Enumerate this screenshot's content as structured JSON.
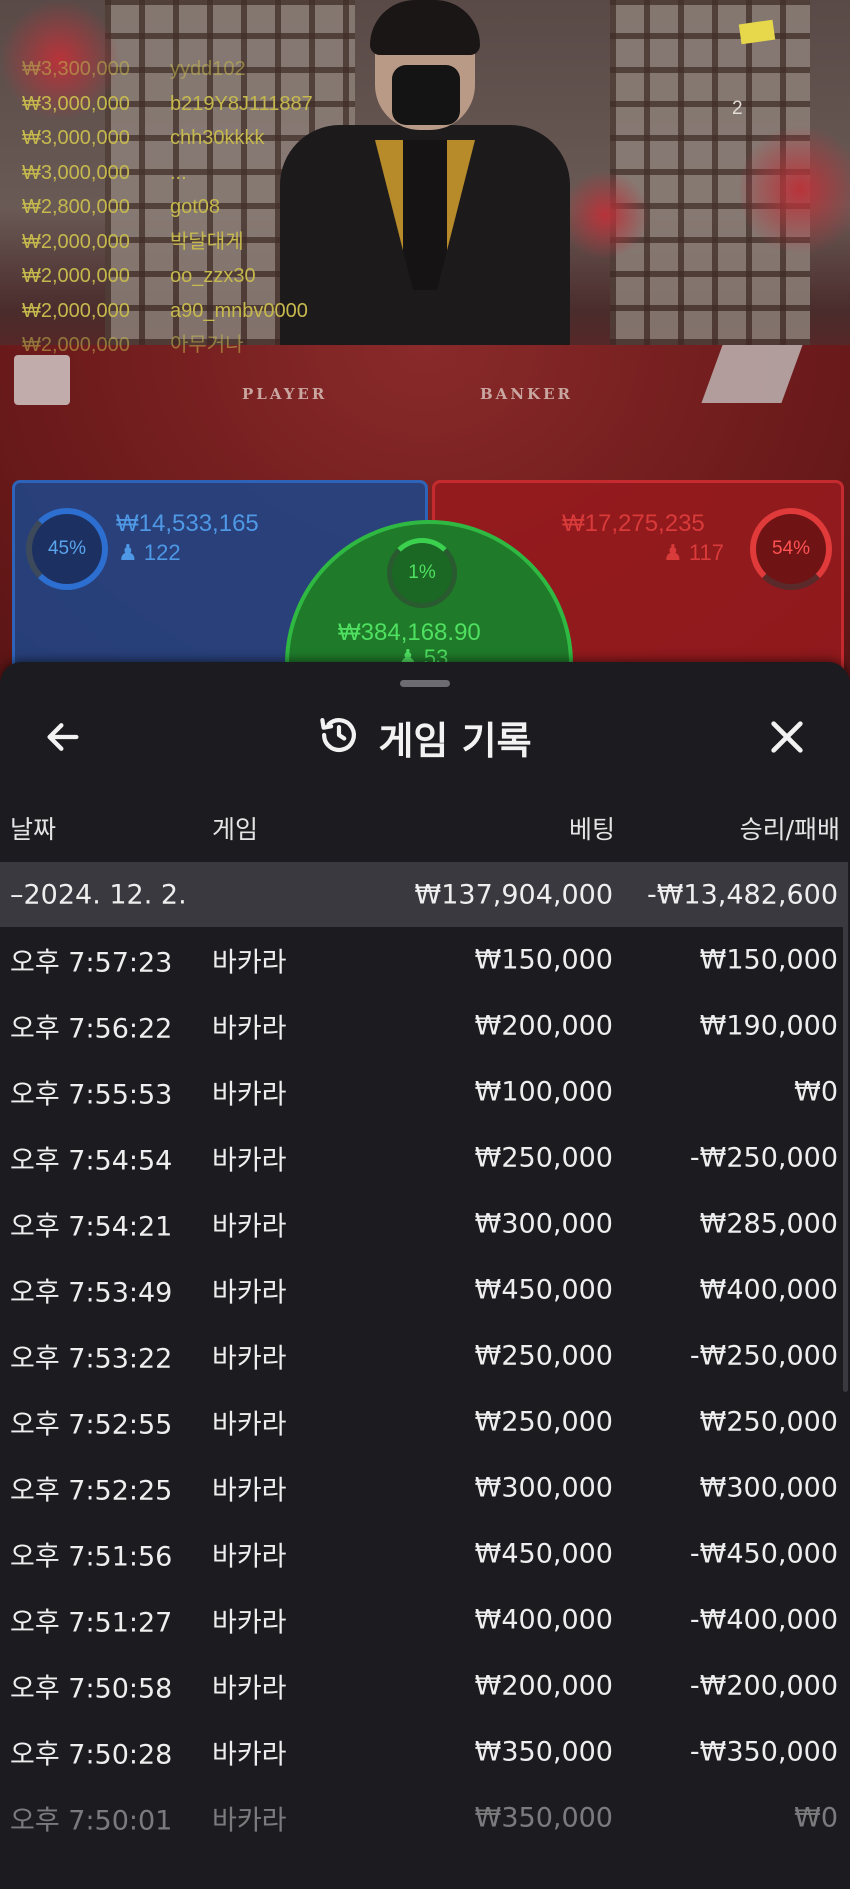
{
  "stream": {
    "viewer_count": "2",
    "table_labels": {
      "player": "PLAYER",
      "banker": "BANKER"
    },
    "recent_wins": [
      {
        "amount": "₩3,300,000",
        "user": "yydd102"
      },
      {
        "amount": "₩3,000,000",
        "user": "b219Y8J111887"
      },
      {
        "amount": "₩3,000,000",
        "user": "chh30kkkk"
      },
      {
        "amount": "₩3,000,000",
        "user": "..."
      },
      {
        "amount": "₩2,800,000",
        "user": "got08"
      },
      {
        "amount": "₩2,000,000",
        "user": "박달대게"
      },
      {
        "amount": "₩2,000,000",
        "user": "oo_zzx30"
      },
      {
        "amount": "₩2,000,000",
        "user": "a90_mnbv0000"
      },
      {
        "amount": "₩2,000,000",
        "user": "아무거나"
      }
    ]
  },
  "bets": {
    "player": {
      "percent": "45%",
      "amount": "₩14,533,165",
      "players": "122",
      "color": "#2c6fd0"
    },
    "banker": {
      "percent": "54%",
      "amount": "₩17,275,235",
      "players": "117",
      "color": "#e03a3a"
    },
    "tie": {
      "percent": "1%",
      "amount": "₩384,168.90",
      "players": "53",
      "color": "#2fb842"
    }
  },
  "history": {
    "title": "게임 기록",
    "icons": {
      "back": "back-arrow-icon",
      "history": "history-icon",
      "close": "close-icon"
    },
    "columns": {
      "date": "날짜",
      "game": "게임",
      "bet": "베팅",
      "result": "승리/패배"
    },
    "day_summary": {
      "date": "–2024. 12. 2.",
      "bet": "₩137,904,000",
      "result": "-₩13,482,600"
    },
    "rows": [
      {
        "time": "오후 7:57:23",
        "game": "바카라",
        "bet": "₩150,000",
        "result": "₩150,000"
      },
      {
        "time": "오후 7:56:22",
        "game": "바카라",
        "bet": "₩200,000",
        "result": "₩190,000"
      },
      {
        "time": "오후 7:55:53",
        "game": "바카라",
        "bet": "₩100,000",
        "result": "₩0"
      },
      {
        "time": "오후 7:54:54",
        "game": "바카라",
        "bet": "₩250,000",
        "result": "-₩250,000"
      },
      {
        "time": "오후 7:54:21",
        "game": "바카라",
        "bet": "₩300,000",
        "result": "₩285,000"
      },
      {
        "time": "오후 7:53:49",
        "game": "바카라",
        "bet": "₩450,000",
        "result": "₩400,000"
      },
      {
        "time": "오후 7:53:22",
        "game": "바카라",
        "bet": "₩250,000",
        "result": "-₩250,000"
      },
      {
        "time": "오후 7:52:55",
        "game": "바카라",
        "bet": "₩250,000",
        "result": "₩250,000"
      },
      {
        "time": "오후 7:52:25",
        "game": "바카라",
        "bet": "₩300,000",
        "result": "₩300,000"
      },
      {
        "time": "오후 7:51:56",
        "game": "바카라",
        "bet": "₩450,000",
        "result": "-₩450,000"
      },
      {
        "time": "오후 7:51:27",
        "game": "바카라",
        "bet": "₩400,000",
        "result": "-₩400,000"
      },
      {
        "time": "오후 7:50:58",
        "game": "바카라",
        "bet": "₩200,000",
        "result": "-₩200,000"
      },
      {
        "time": "오후 7:50:28",
        "game": "바카라",
        "bet": "₩350,000",
        "result": "-₩350,000"
      },
      {
        "time": "오후 7:50:01",
        "game": "바카라",
        "bet": "₩350,000",
        "result": "₩0"
      }
    ]
  }
}
